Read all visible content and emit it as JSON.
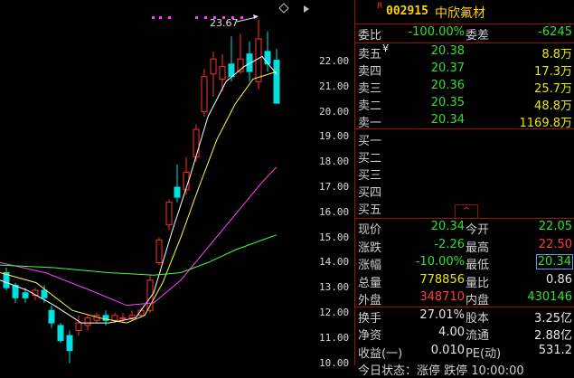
{
  "stock": {
    "flag": "R",
    "code": "002915",
    "name": "中欣氟材"
  },
  "chart": {
    "marker_label": "23.67",
    "y_ticks": [
      "22.00",
      "21.00",
      "20.00",
      "19.00",
      "18.00",
      "17.00",
      "16.00",
      "15.00",
      "14.00",
      "13.00",
      "12.00",
      "11.00",
      "10.00"
    ],
    "colors": {
      "up": "#ff3030",
      "down": "#00e0e0",
      "ma5": "#ffffff",
      "ma10": "#ffff40",
      "ma20": "#ff40ff",
      "ma60": "#40ff40"
    }
  },
  "weibi": {
    "label": "委比",
    "value": "-100.00%",
    "label2": "委差",
    "value2": "-6245"
  },
  "sell": [
    {
      "label": "卖五",
      "sym": "¥",
      "price": "20.38",
      "vol": "8.8万"
    },
    {
      "label": "卖四",
      "sym": "",
      "price": "20.37",
      "vol": "17.3万"
    },
    {
      "label": "卖三",
      "sym": "",
      "price": "20.36",
      "vol": "25.7万"
    },
    {
      "label": "卖二",
      "sym": "",
      "price": "20.35",
      "vol": "48.8万"
    },
    {
      "label": "卖一",
      "sym": "",
      "price": "20.34",
      "vol": "1169.8万"
    }
  ],
  "buy": [
    {
      "label": "买一"
    },
    {
      "label": "买二"
    },
    {
      "label": "买三"
    },
    {
      "label": "买四"
    },
    {
      "label": "买五"
    }
  ],
  "collapse_icon": "^",
  "quote": [
    {
      "l1": "现价",
      "v1": "20.34",
      "l2": "今开",
      "v2": "22.05"
    },
    {
      "l1": "涨跌",
      "v1": "-2.26",
      "l2": "最高",
      "v2": "22.50"
    },
    {
      "l1": "涨幅",
      "v1": "-10.00%",
      "l2": "最低",
      "v2": "20.34"
    },
    {
      "l1": "总量",
      "v1": "778856",
      "l2": "量比",
      "v2": "0.86"
    },
    {
      "l1": "外盘",
      "v1": "348710",
      "l2": "内盘",
      "v2": "430146"
    },
    {
      "l1": "换手",
      "v1": "27.01%",
      "l2": "股本",
      "v2": "3.25亿"
    },
    {
      "l1": "净资",
      "v1": "4.00",
      "l2": "流通",
      "v2": "2.88亿"
    },
    {
      "l1": "收益(一)",
      "v1": "0.010",
      "l2": "PE(动)",
      "v2": "531.2"
    }
  ],
  "bottom_partial": "今日状态：涨停 跌停 10:00:00"
}
